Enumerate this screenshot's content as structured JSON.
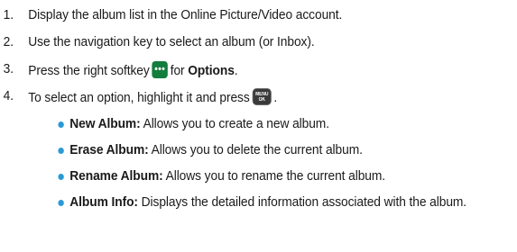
{
  "steps": [
    {
      "num": "1.",
      "text": "Display the album list in the Online Picture/Video account."
    },
    {
      "num": "2.",
      "text": "Use the navigation key to select an album (or Inbox)."
    },
    {
      "num": "3.",
      "pre": "Press the right softkey",
      "mid": "for",
      "bold": "Options",
      "post": "."
    },
    {
      "num": "4.",
      "pre": "To select an option, highlight it and press",
      "post": "."
    }
  ],
  "keys": {
    "softkey_icon": "ellipsis-softkey-icon",
    "softkey_label": "•••",
    "menu_icon": "menu-ok-key-icon",
    "menu_top": "MENU",
    "menu_bottom": "OK"
  },
  "options": [
    {
      "label": "New Album:",
      "desc": "Allows you to create a new album."
    },
    {
      "label": "Erase Album:",
      "desc": "Allows you to delete the current album."
    },
    {
      "label": "Rename Album:",
      "desc": "Allows you to rename the current album."
    },
    {
      "label": "Album Info:",
      "desc": "Displays the detailed information associated with the album."
    }
  ],
  "colors": {
    "bullet": "#2a9ad6",
    "softkey": "#137d3d",
    "menu_key": "#3a3a3a",
    "text": "#1a1a1a"
  }
}
